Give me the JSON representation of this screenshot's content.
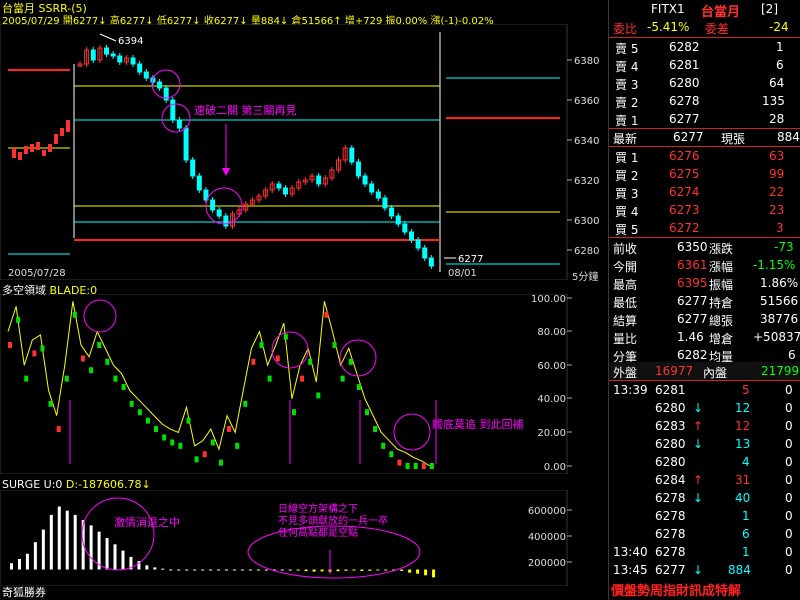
{
  "colors": {
    "up": "#ff3030",
    "down": "#00ffff",
    "green_bar": "#00e000",
    "yellow": "#ffff00",
    "magenta": "#ff00ff",
    "cyan": "#00ffff",
    "red": "#ff2020"
  },
  "main": {
    "title": "台當月 SSRR-(5)",
    "ohlc_line": "2005/07/29 開6277↓ 高6277↓ 低6277↓ 收6277↓ 量884↓ 倉51566↑ 增+729 振0.00% 漲(-1)-0.02%",
    "y_ticks": [
      "6380",
      "6360",
      "6340",
      "6320",
      "6300",
      "6280"
    ],
    "high_label": "6394",
    "low_label": "6277",
    "date_left": "2005/07/28",
    "date_right": "08/01",
    "interval": "5分鐘",
    "annotation": "速破二關 第三關再見"
  },
  "blade": {
    "title": "多空領域",
    "param": "BLADE:0",
    "y_ticks": [
      "100.00",
      "80.00",
      "60.00",
      "40.00",
      "20.00",
      "0.00"
    ],
    "annotation": "觸底莫追 到此回補"
  },
  "surge": {
    "title": "SURGE U:0",
    "param": "D:-187606.78↓",
    "y_ticks": [
      "600000",
      "400000",
      "200000"
    ],
    "annotation_left": "激情消退之中",
    "annotation_right": "日線空方架構之下 不見多頭獻放的一兵一卒 任何高點都是空點",
    "footer": "奇狐勝券"
  },
  "quote": {
    "symbol": "FITX1",
    "name": "台當月",
    "window": "[2]",
    "ratio_label": "委比",
    "ratio_value": "-5.41%",
    "diff_label": "委差",
    "diff_value": "-24",
    "asks": [
      {
        "label": "賣 5",
        "price": "6282",
        "vol": "1"
      },
      {
        "label": "賣 4",
        "price": "6281",
        "vol": "6"
      },
      {
        "label": "賣 3",
        "price": "6280",
        "vol": "64"
      },
      {
        "label": "賣 2",
        "price": "6278",
        "vol": "135"
      },
      {
        "label": "賣 1",
        "price": "6277",
        "vol": "28"
      }
    ],
    "last_label": "最新",
    "last_value": "6277",
    "cur_label": "現張",
    "cur_value": "884",
    "bids": [
      {
        "label": "買 1",
        "price": "6276",
        "vol": "63"
      },
      {
        "label": "買 2",
        "price": "6275",
        "vol": "99"
      },
      {
        "label": "買 3",
        "price": "6274",
        "vol": "22"
      },
      {
        "label": "買 4",
        "price": "6273",
        "vol": "23"
      },
      {
        "label": "買 5",
        "price": "6272",
        "vol": "3"
      }
    ],
    "stats": [
      {
        "l1": "前收",
        "v1": "6350",
        "l2": "漲跌",
        "v2": "-73",
        "c1": "#fff",
        "c2": "#00ff00"
      },
      {
        "l1": "今開",
        "v1": "6361",
        "l2": "漲幅",
        "v2": "-1.15%",
        "c1": "#ff3030",
        "c2": "#00ff00"
      },
      {
        "l1": "最高",
        "v1": "6395",
        "l2": "振幅",
        "v2": "1.86%",
        "c1": "#ff3030",
        "c2": "#fff"
      },
      {
        "l1": "最低",
        "v1": "6277",
        "l2": "持倉",
        "v2": "51566",
        "c1": "#fff",
        "c2": "#fff"
      },
      {
        "l1": "結算",
        "v1": "6277",
        "l2": "總張",
        "v2": "38776",
        "c1": "#fff",
        "c2": "#fff"
      },
      {
        "l1": "量比",
        "v1": "1.46",
        "l2": "增倉",
        "v2": "+50837",
        "c1": "#fff",
        "c2": "#fff"
      },
      {
        "l1": "分筆",
        "v1": "6282",
        "l2": "均量",
        "v2": "6",
        "c1": "#fff",
        "c2": "#fff"
      }
    ],
    "outer_label": "外盤",
    "outer_value": "16977",
    "inner_label": "內盤",
    "inner_value": "21799",
    "ticks": [
      {
        "time": "13:39",
        "price": "6281",
        "arrow": "",
        "vol": "5",
        "vcolor": "#ff3030",
        "oi": "0"
      },
      {
        "time": "",
        "price": "6280",
        "arrow": "↓",
        "vol": "12",
        "vcolor": "#00ffff",
        "oi": "0"
      },
      {
        "time": "",
        "price": "6283",
        "arrow": "↑",
        "vol": "12",
        "vcolor": "#ff3030",
        "oi": "0"
      },
      {
        "time": "",
        "price": "6280",
        "arrow": "↓",
        "vol": "13",
        "vcolor": "#00ffff",
        "oi": "0"
      },
      {
        "time": "",
        "price": "6280",
        "arrow": "",
        "vol": "4",
        "vcolor": "#00ffff",
        "oi": "0"
      },
      {
        "time": "",
        "price": "6284",
        "arrow": "↑",
        "vol": "31",
        "vcolor": "#ff3030",
        "oi": "0"
      },
      {
        "time": "",
        "price": "6278",
        "arrow": "↓",
        "vol": "40",
        "vcolor": "#00ffff",
        "oi": "0"
      },
      {
        "time": "",
        "price": "6278",
        "arrow": "",
        "vol": "1",
        "vcolor": "#00ffff",
        "oi": "0"
      },
      {
        "time": "",
        "price": "6278",
        "arrow": "",
        "vol": "6",
        "vcolor": "#00ffff",
        "oi": "0"
      },
      {
        "time": "13:40",
        "price": "6278",
        "arrow": "",
        "vol": "1",
        "vcolor": "#00ffff",
        "oi": "0"
      },
      {
        "time": "13:45",
        "price": "6277",
        "arrow": "↓",
        "vol": "884",
        "vcolor": "#00ffff",
        "oi": "0"
      }
    ],
    "footer": "價盤勢周指財訊成特解"
  },
  "chart_data": [
    {
      "type": "line",
      "title": "台當月 SSRR-(5)",
      "ylim": [
        6275,
        6395
      ],
      "series": [
        {
          "values": [
            6378,
            6385,
            6380,
            6386,
            6383,
            6382,
            6379,
            6381,
            6378,
            6374,
            6371,
            6369,
            6366,
            6360,
            6350,
            6346,
            6330,
            6322,
            6315,
            6310,
            6305,
            6302,
            6297,
            6303,
            6305,
            6308,
            6310,
            6312,
            6315,
            6318,
            6316,
            6313,
            6316,
            6319,
            6320,
            6322,
            6318,
            6321,
            6325,
            6330,
            6336,
            6329,
            6322,
            6318,
            6314,
            6311,
            6306,
            6302,
            6298,
            6294,
            6290,
            6286,
            6281,
            6277
          ]
        }
      ]
    },
    {
      "type": "line",
      "title": "多空領域",
      "ylim": [
        0,
        100
      ],
      "series": [
        {
          "values": [
            80,
            95,
            60,
            75,
            78,
            45,
            30,
            60,
            98,
            72,
            65,
            80,
            70,
            60,
            55,
            45,
            40,
            35,
            30,
            25,
            22,
            20,
            35,
            12,
            15,
            22,
            10,
            30,
            20,
            45,
            70,
            80,
            60,
            72,
            85,
            40,
            60,
            70,
            50,
            98,
            80,
            60,
            70,
            55,
            40,
            30,
            20,
            15,
            10,
            8,
            5,
            3,
            0
          ]
        }
      ]
    },
    {
      "type": "bar",
      "title": "SURGE U:0",
      "ylim": [
        -100000,
        700000
      ],
      "series": [
        {
          "values": [
            60000,
            100000,
            150000,
            260000,
            380000,
            520000,
            600000,
            560000,
            520000,
            470000,
            420000,
            360000,
            300000,
            240000,
            180000,
            120000,
            80000,
            40000,
            20000,
            8000,
            0,
            0,
            0,
            0,
            0,
            0,
            0,
            0,
            0,
            0,
            0,
            0,
            0,
            0,
            0,
            0,
            -10000,
            -15000,
            -20000,
            -18000,
            -22000,
            -16000,
            -12000,
            -10000,
            -14000,
            -12000,
            -8000,
            -10000,
            -6000,
            -14000,
            -30000,
            -40000,
            -55000,
            -75000
          ]
        }
      ]
    }
  ]
}
